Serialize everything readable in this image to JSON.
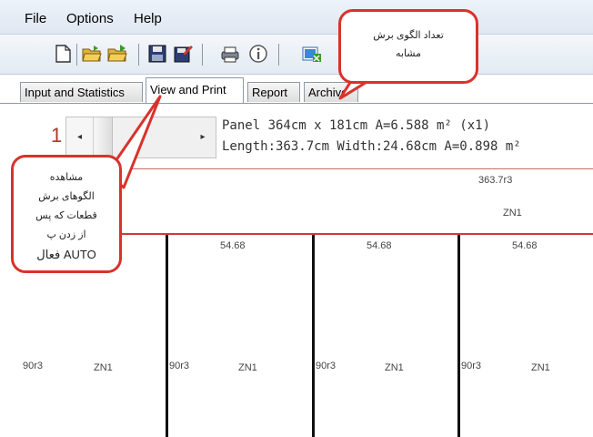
{
  "menu": [
    "File",
    "Options",
    "Help"
  ],
  "tabs": [
    {
      "label": "Input and Statistics"
    },
    {
      "label": "View and Print"
    },
    {
      "label": "Report"
    },
    {
      "label": "Archive"
    }
  ],
  "toolbar_icons": [
    "new-file-icon",
    "open-folder-icon",
    "open-folder-alt-icon",
    "save-icon",
    "save-as-icon",
    "print-icon",
    "info-icon",
    "export-icon"
  ],
  "navigation": {
    "page_number": "1",
    "scroll_left": "◂",
    "scroll_right": "▸"
  },
  "panel_info": {
    "line1": "Panel 364cm x 181cm A=6.588 m² (x1)",
    "line2": "Length:363.7cm Width:24.68cm A=0.898 m²"
  },
  "strip": {
    "top_label": "363.7r3",
    "center_label": "ZN1"
  },
  "columns": [
    {
      "width_label": "",
      "side_label": "90r3",
      "center_label": "ZN1"
    },
    {
      "width_label": "54.68",
      "side_label": "90r3",
      "center_label": "ZN1"
    },
    {
      "width_label": "54.68",
      "side_label": "90r3",
      "center_label": "ZN1"
    },
    {
      "width_label": "54.68",
      "side_label": "90r3",
      "center_label": "ZN1"
    }
  ],
  "callouts": {
    "top_right": {
      "line1": "تعداد الگوی برش",
      "line2": "مشابه"
    },
    "left": {
      "line1": "مشاهده",
      "line2": "الگوهای برش",
      "line3": "قطعات که پس",
      "line4": "از زدن پ",
      "line5": "فعال AUTO"
    }
  },
  "colors": {
    "accent_red": "#d9322b",
    "page_number": "#a9392b"
  }
}
